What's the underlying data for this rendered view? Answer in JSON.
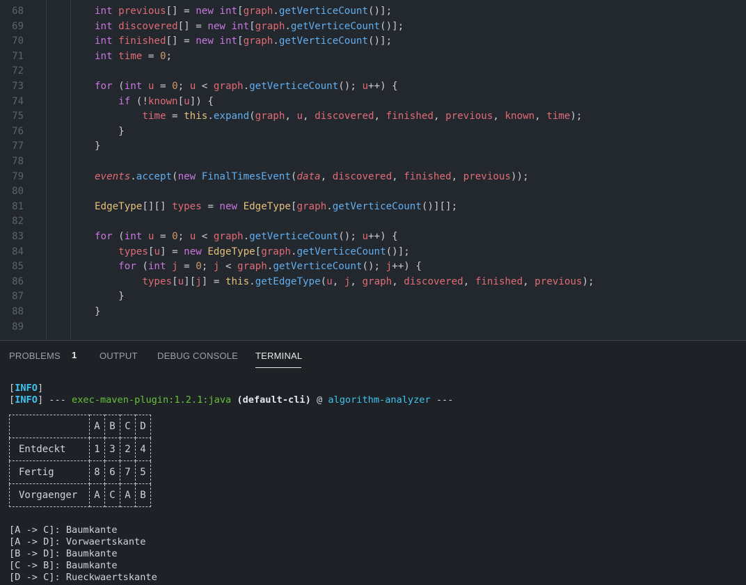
{
  "editor": {
    "lines": [
      {
        "n": "68",
        "segs": [
          [
            "ty",
            "int "
          ],
          [
            "var",
            "previous"
          ],
          [
            "op",
            "[] = "
          ],
          [
            "kw",
            "new "
          ],
          [
            "ty",
            "int"
          ],
          [
            "op",
            "["
          ],
          [
            "var",
            "graph"
          ],
          [
            "op",
            "."
          ],
          [
            "fn",
            "getVerticeCount"
          ],
          [
            "op",
            "()];"
          ]
        ]
      },
      {
        "n": "69",
        "segs": [
          [
            "ty",
            "int "
          ],
          [
            "var",
            "discovered"
          ],
          [
            "op",
            "[] = "
          ],
          [
            "kw",
            "new "
          ],
          [
            "ty",
            "int"
          ],
          [
            "op",
            "["
          ],
          [
            "var",
            "graph"
          ],
          [
            "op",
            "."
          ],
          [
            "fn",
            "getVerticeCount"
          ],
          [
            "op",
            "()];"
          ]
        ]
      },
      {
        "n": "70",
        "segs": [
          [
            "ty",
            "int "
          ],
          [
            "var",
            "finished"
          ],
          [
            "op",
            "[] = "
          ],
          [
            "kw",
            "new "
          ],
          [
            "ty",
            "int"
          ],
          [
            "op",
            "["
          ],
          [
            "var",
            "graph"
          ],
          [
            "op",
            "."
          ],
          [
            "fn",
            "getVerticeCount"
          ],
          [
            "op",
            "()];"
          ]
        ]
      },
      {
        "n": "71",
        "segs": [
          [
            "ty",
            "int "
          ],
          [
            "var",
            "time"
          ],
          [
            "op",
            " = "
          ],
          [
            "num",
            "0"
          ],
          [
            "op",
            ";"
          ]
        ]
      },
      {
        "n": "72",
        "segs": []
      },
      {
        "n": "73",
        "segs": [
          [
            "kw",
            "for "
          ],
          [
            "op",
            "("
          ],
          [
            "ty",
            "int "
          ],
          [
            "var",
            "u"
          ],
          [
            "op",
            " = "
          ],
          [
            "num",
            "0"
          ],
          [
            "op",
            "; "
          ],
          [
            "var",
            "u"
          ],
          [
            "op",
            " < "
          ],
          [
            "var",
            "graph"
          ],
          [
            "op",
            "."
          ],
          [
            "fn",
            "getVerticeCount"
          ],
          [
            "op",
            "(); "
          ],
          [
            "var",
            "u"
          ],
          [
            "op",
            "++) {"
          ]
        ]
      },
      {
        "n": "74",
        "segs": [
          [
            "op",
            "    "
          ],
          [
            "kw",
            "if "
          ],
          [
            "op",
            "(!"
          ],
          [
            "var",
            "known"
          ],
          [
            "op",
            "["
          ],
          [
            "var",
            "u"
          ],
          [
            "op",
            "]) {"
          ]
        ]
      },
      {
        "n": "75",
        "segs": [
          [
            "op",
            "        "
          ],
          [
            "var",
            "time"
          ],
          [
            "op",
            " = "
          ],
          [
            "thiskw",
            "this"
          ],
          [
            "op",
            "."
          ],
          [
            "fn",
            "expand"
          ],
          [
            "op",
            "("
          ],
          [
            "var",
            "graph"
          ],
          [
            "op",
            ", "
          ],
          [
            "var",
            "u"
          ],
          [
            "op",
            ", "
          ],
          [
            "var",
            "discovered"
          ],
          [
            "op",
            ", "
          ],
          [
            "var",
            "finished"
          ],
          [
            "op",
            ", "
          ],
          [
            "var",
            "previous"
          ],
          [
            "op",
            ", "
          ],
          [
            "var",
            "known"
          ],
          [
            "op",
            ", "
          ],
          [
            "var",
            "time"
          ],
          [
            "op",
            ");"
          ]
        ]
      },
      {
        "n": "76",
        "segs": [
          [
            "op",
            "    }"
          ]
        ]
      },
      {
        "n": "77",
        "segs": [
          [
            "op",
            "}"
          ]
        ]
      },
      {
        "n": "78",
        "segs": []
      },
      {
        "n": "79",
        "segs": [
          [
            "it",
            "events"
          ],
          [
            "op",
            "."
          ],
          [
            "fn",
            "accept"
          ],
          [
            "op",
            "("
          ],
          [
            "kw",
            "new "
          ],
          [
            "fn",
            "FinalTimesEvent"
          ],
          [
            "op",
            "("
          ],
          [
            "it",
            "data"
          ],
          [
            "op",
            ", "
          ],
          [
            "var",
            "discovered"
          ],
          [
            "op",
            ", "
          ],
          [
            "var",
            "finished"
          ],
          [
            "op",
            ", "
          ],
          [
            "var",
            "previous"
          ],
          [
            "op",
            "));"
          ]
        ]
      },
      {
        "n": "80",
        "segs": []
      },
      {
        "n": "81",
        "segs": [
          [
            "cls",
            "EdgeType"
          ],
          [
            "op",
            "[][] "
          ],
          [
            "var",
            "types"
          ],
          [
            "op",
            " = "
          ],
          [
            "kw",
            "new "
          ],
          [
            "cls",
            "EdgeType"
          ],
          [
            "op",
            "["
          ],
          [
            "var",
            "graph"
          ],
          [
            "op",
            "."
          ],
          [
            "fn",
            "getVerticeCount"
          ],
          [
            "op",
            "()][];"
          ]
        ]
      },
      {
        "n": "82",
        "segs": []
      },
      {
        "n": "83",
        "segs": [
          [
            "kw",
            "for "
          ],
          [
            "op",
            "("
          ],
          [
            "ty",
            "int "
          ],
          [
            "var",
            "u"
          ],
          [
            "op",
            " = "
          ],
          [
            "num",
            "0"
          ],
          [
            "op",
            "; "
          ],
          [
            "var",
            "u"
          ],
          [
            "op",
            " < "
          ],
          [
            "var",
            "graph"
          ],
          [
            "op",
            "."
          ],
          [
            "fn",
            "getVerticeCount"
          ],
          [
            "op",
            "(); "
          ],
          [
            "var",
            "u"
          ],
          [
            "op",
            "++) {"
          ]
        ]
      },
      {
        "n": "84",
        "segs": [
          [
            "op",
            "    "
          ],
          [
            "var",
            "types"
          ],
          [
            "op",
            "["
          ],
          [
            "var",
            "u"
          ],
          [
            "op",
            "] = "
          ],
          [
            "kw",
            "new "
          ],
          [
            "cls",
            "EdgeType"
          ],
          [
            "op",
            "["
          ],
          [
            "var",
            "graph"
          ],
          [
            "op",
            "."
          ],
          [
            "fn",
            "getVerticeCount"
          ],
          [
            "op",
            "()];"
          ]
        ]
      },
      {
        "n": "85",
        "segs": [
          [
            "op",
            "    "
          ],
          [
            "kw",
            "for "
          ],
          [
            "op",
            "("
          ],
          [
            "ty",
            "int "
          ],
          [
            "var",
            "j"
          ],
          [
            "op",
            " = "
          ],
          [
            "num",
            "0"
          ],
          [
            "op",
            "; "
          ],
          [
            "var",
            "j"
          ],
          [
            "op",
            " < "
          ],
          [
            "var",
            "graph"
          ],
          [
            "op",
            "."
          ],
          [
            "fn",
            "getVerticeCount"
          ],
          [
            "op",
            "(); "
          ],
          [
            "var",
            "j"
          ],
          [
            "op",
            "++) {"
          ]
        ]
      },
      {
        "n": "86",
        "segs": [
          [
            "op",
            "        "
          ],
          [
            "var",
            "types"
          ],
          [
            "op",
            "["
          ],
          [
            "var",
            "u"
          ],
          [
            "op",
            "]["
          ],
          [
            "var",
            "j"
          ],
          [
            "op",
            "] = "
          ],
          [
            "thiskw",
            "this"
          ],
          [
            "op",
            "."
          ],
          [
            "fn",
            "getEdgeType"
          ],
          [
            "op",
            "("
          ],
          [
            "var",
            "u"
          ],
          [
            "op",
            ", "
          ],
          [
            "var",
            "j"
          ],
          [
            "op",
            ", "
          ],
          [
            "var",
            "graph"
          ],
          [
            "op",
            ", "
          ],
          [
            "var",
            "discovered"
          ],
          [
            "op",
            ", "
          ],
          [
            "var",
            "finished"
          ],
          [
            "op",
            ", "
          ],
          [
            "var",
            "previous"
          ],
          [
            "op",
            ");"
          ]
        ]
      },
      {
        "n": "87",
        "segs": [
          [
            "op",
            "    }"
          ]
        ]
      },
      {
        "n": "88",
        "segs": [
          [
            "op",
            "}"
          ]
        ]
      },
      {
        "n": "89",
        "segs": []
      }
    ]
  },
  "panel": {
    "tabs": {
      "problems": "PROBLEMS",
      "problems_count": "1",
      "output": "OUTPUT",
      "debug_console": "DEBUG CONSOLE",
      "terminal": "TERMINAL"
    },
    "terminal": {
      "info_tag": "INFO",
      "line2_dashes_left": " --- ",
      "plugin": "exec-maven-plugin:1.2.1:java",
      "execution": "(default-cli)",
      "at": " @ ",
      "project": "algorithm-analyzer",
      "line2_dashes_right": " ---",
      "table": {
        "headers": [
          "",
          "A",
          "B",
          "C",
          "D"
        ],
        "rows": [
          [
            "Entdeckt",
            "1",
            "3",
            "2",
            "4"
          ],
          [
            "Fertig",
            "8",
            "6",
            "7",
            "5"
          ],
          [
            "Vorgaenger",
            "A",
            "C",
            "A",
            "B"
          ]
        ]
      },
      "edges": [
        "[A -> C]: Baumkante",
        "[A -> D]: Vorwaertskante",
        "[B -> D]: Baumkante",
        "[C -> B]: Baumkante",
        "[D -> C]: Rueckwaertskante"
      ]
    }
  }
}
